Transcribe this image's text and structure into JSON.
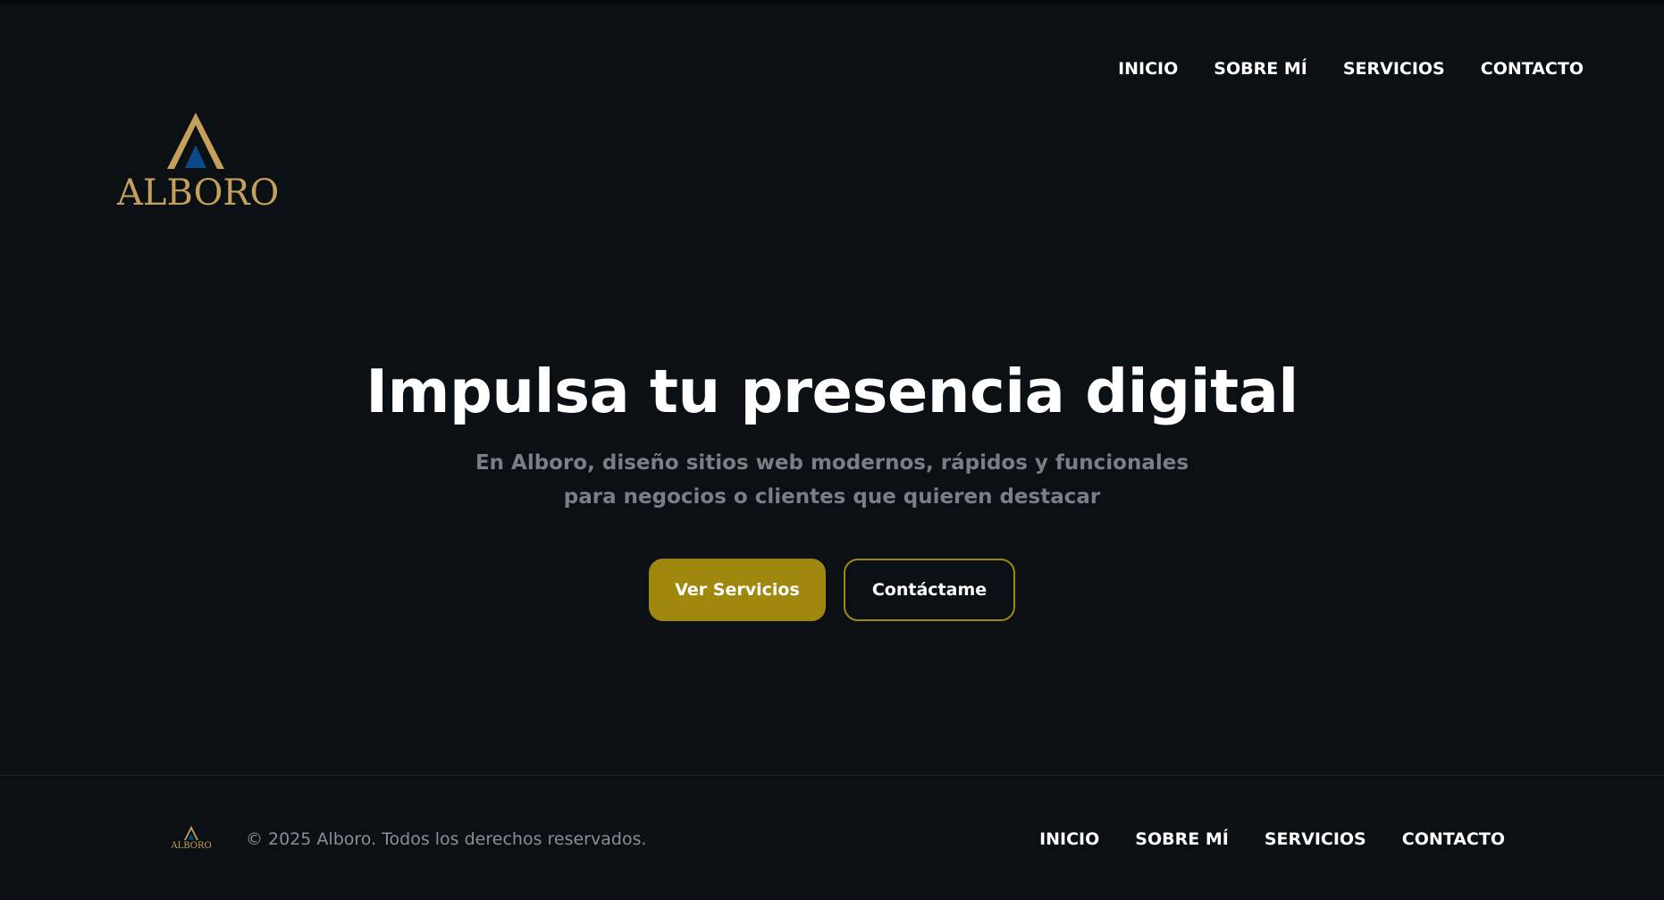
{
  "brand": {
    "name": "ALBORO",
    "logo_icon": "alboro-logo-icon",
    "gold": "#c4a05a",
    "accent_blue": "#0b4a86"
  },
  "header": {
    "nav": [
      {
        "label": "INICIO"
      },
      {
        "label": "SOBRE MÍ"
      },
      {
        "label": "SERVICIOS"
      },
      {
        "label": "CONTACTO"
      }
    ]
  },
  "hero": {
    "title": "Impulsa tu presencia digital",
    "subtitle": "En Alboro, diseño sitios web modernos, rápidos y funcionales para negocios o clientes que quieren destacar",
    "primary_button": "Ver Servicios",
    "secondary_button": "Contáctame",
    "button_color": "#a0870e"
  },
  "footer": {
    "brand_name": "ALBORO",
    "copyright": "© 2025 Alboro. Todos los derechos reservados.",
    "nav": [
      {
        "label": "INICIO"
      },
      {
        "label": "SOBRE MÍ"
      },
      {
        "label": "SERVICIOS"
      },
      {
        "label": "CONTACTO"
      }
    ]
  },
  "colors": {
    "background": "#0b1014",
    "text": "#ffffff",
    "muted_text": "#7b7f85"
  }
}
